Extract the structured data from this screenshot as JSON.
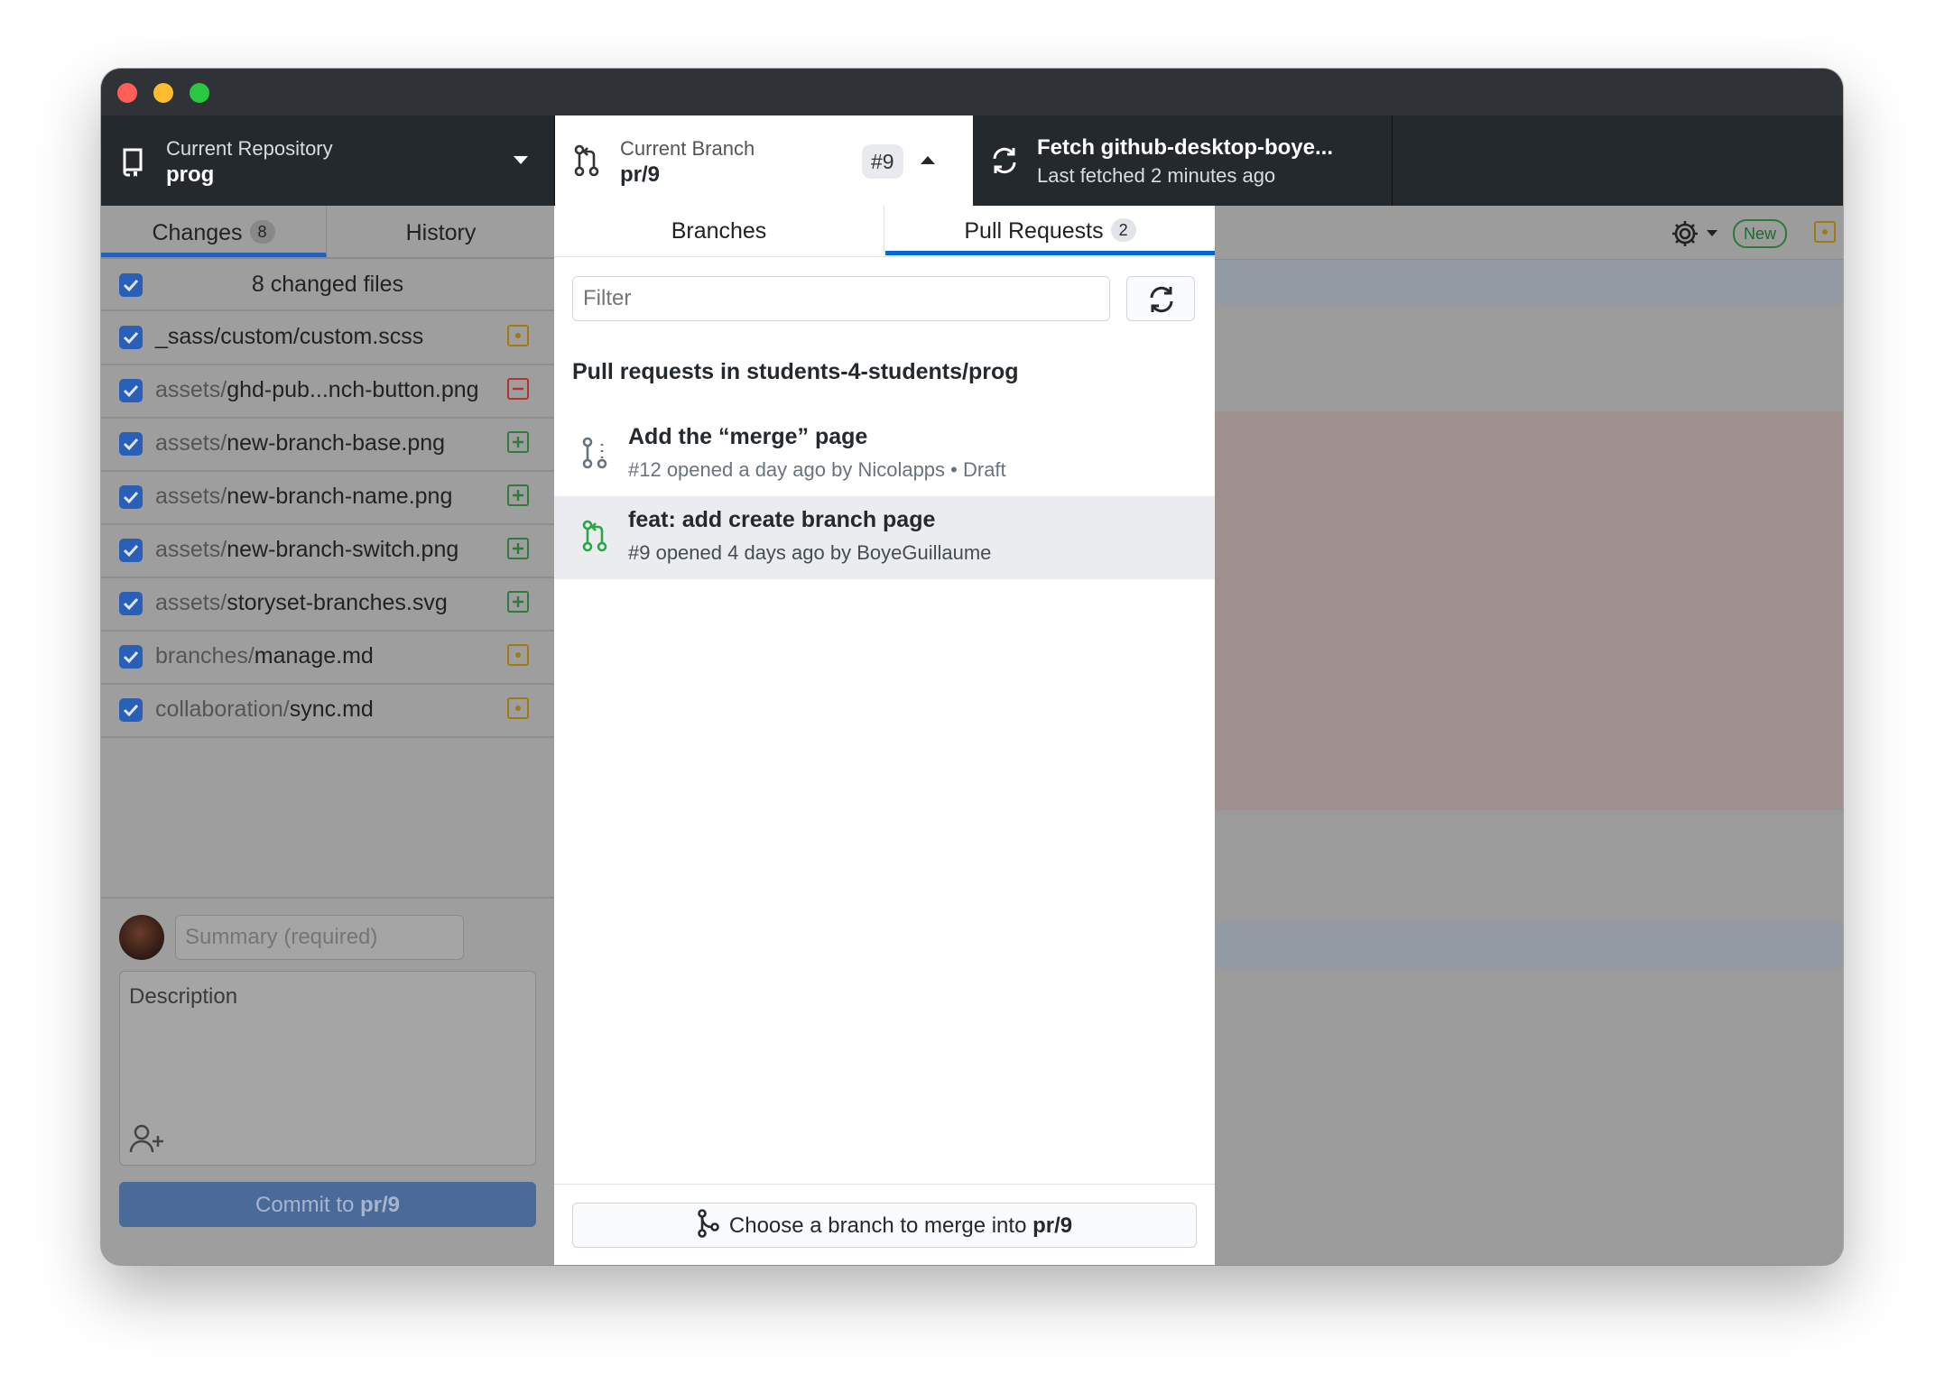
{
  "toolbar": {
    "repo_label": "Current Repository",
    "repo_name": "prog",
    "branch_label": "Current Branch",
    "branch_name": "pr/9",
    "branch_pr_badge": "#9",
    "fetch_title": "Fetch github-desktop-boye...",
    "fetch_subtitle": "Last fetched 2 minutes ago"
  },
  "left": {
    "tabs": [
      {
        "label": "Changes",
        "count": "8"
      },
      {
        "label": "History"
      }
    ],
    "changed_files_label": "8 changed files",
    "files": [
      {
        "dir": "",
        "name": "_sass/custom/custom.scss",
        "status": "modified"
      },
      {
        "dir": "assets/",
        "name": "ghd-pub...nch-button.png",
        "status": "deleted"
      },
      {
        "dir": "assets/",
        "name": "new-branch-base.png",
        "status": "added"
      },
      {
        "dir": "assets/",
        "name": "new-branch-name.png",
        "status": "added"
      },
      {
        "dir": "assets/",
        "name": "new-branch-switch.png",
        "status": "added"
      },
      {
        "dir": "assets/",
        "name": "storyset-branches.svg",
        "status": "added"
      },
      {
        "dir": "branches/",
        "name": "manage.md",
        "status": "modified"
      },
      {
        "dir": "collaboration/",
        "name": "sync.md",
        "status": "modified"
      }
    ],
    "summary_placeholder": "Summary (required)",
    "description_placeholder": "Description",
    "commit_prefix": "Commit to ",
    "commit_branch": "pr/9"
  },
  "dropdown": {
    "tabs": [
      {
        "label": "Branches"
      },
      {
        "label": "Pull Requests",
        "count": "2"
      }
    ],
    "filter_placeholder": "Filter",
    "heading": "Pull requests in students-4-students/prog",
    "pull_requests": [
      {
        "title": "Add the “merge” page",
        "meta": "#12 opened a day ago by Nicolapps",
        "draft": "Draft",
        "state": "draft"
      },
      {
        "title": "feat: add create branch page",
        "meta": "#9 opened 4 days ago by BoyeGuillaume",
        "state": "open"
      }
    ],
    "merge_prefix": "Choose a branch to merge into ",
    "merge_branch": "pr/9"
  },
  "right": {
    "new_badge": "New"
  },
  "colors": {
    "toolbar_bg": "#24292e",
    "accent_blue": "#0366d6",
    "status_added": "#28a745",
    "status_modified": "#b08800",
    "status_deleted": "#cb2431"
  },
  "icons": {
    "repo": "repo-icon",
    "branch": "git-branch-icon",
    "sync": "sync-icon",
    "pull_request": "git-pull-request-icon",
    "merge": "git-merge-icon",
    "gear": "gear-icon",
    "add_coauthor": "person-add-icon"
  }
}
